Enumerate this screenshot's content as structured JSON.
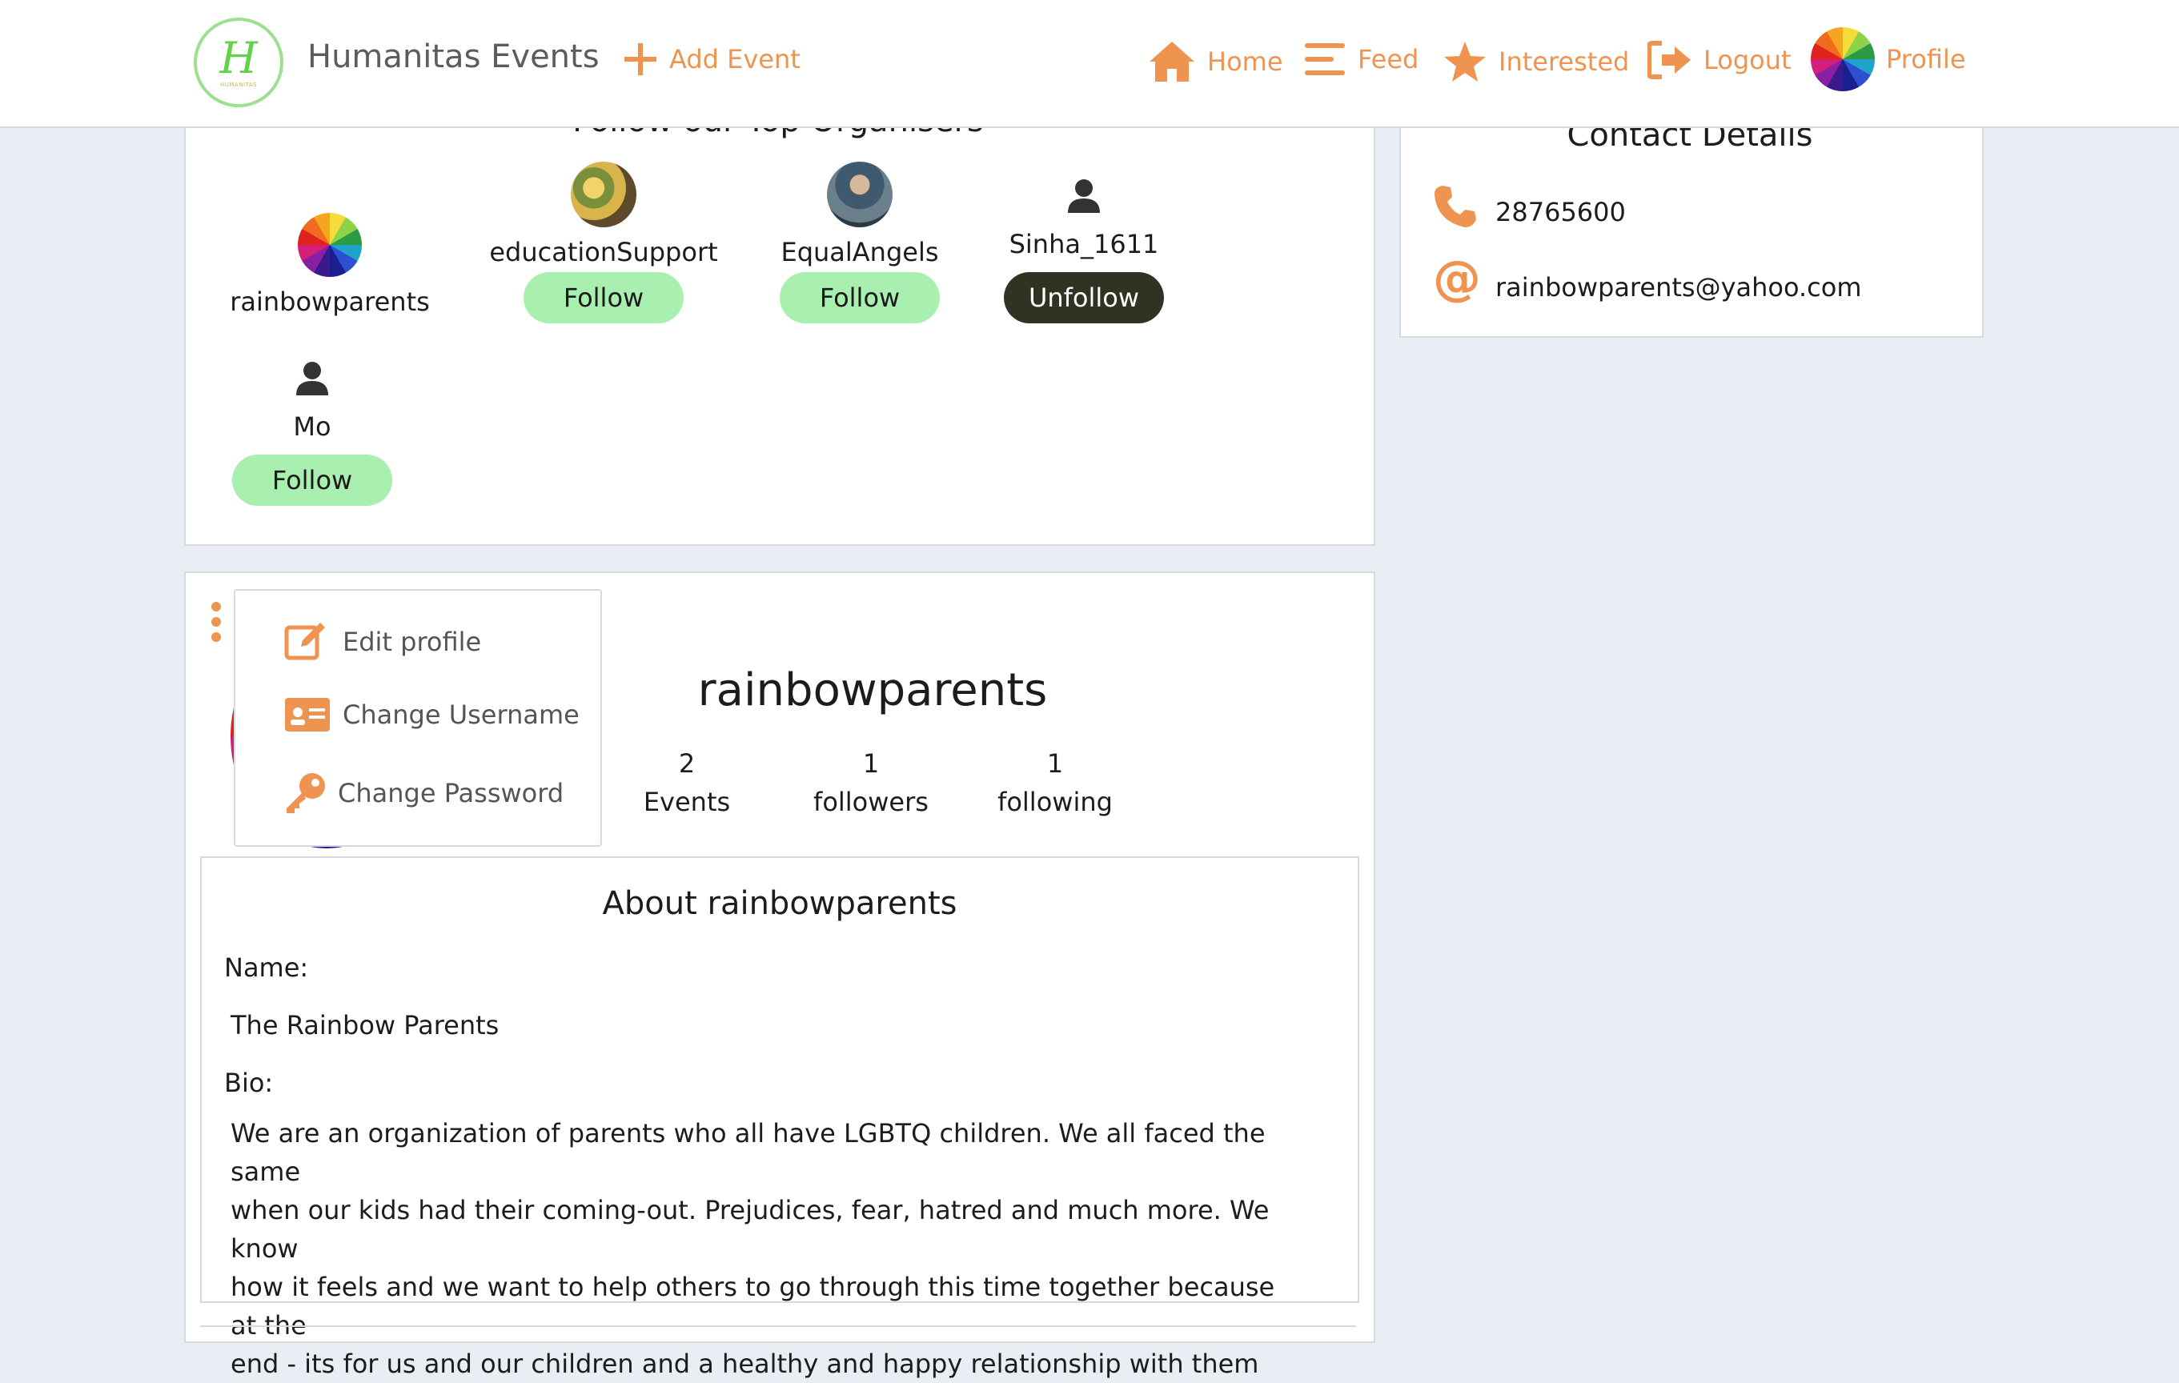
{
  "nav": {
    "logo_letter": "H",
    "logo_small_text": "HUMANITAS",
    "brand": "Humanitas Events",
    "add_event": "Add Event",
    "home": "Home",
    "feed": "Feed",
    "interested": "Interested",
    "logout": "Logout",
    "profile": "Profile"
  },
  "organisers": {
    "title": "Follow our Top Organisers",
    "items": [
      {
        "name": "rainbowparents"
      },
      {
        "name": "educationSupport",
        "button": "Follow"
      },
      {
        "name": "EqualAngels",
        "button": "Follow"
      },
      {
        "name": "Sinha_1611",
        "button": "Unfollow"
      },
      {
        "name": "Mo",
        "button": "Follow"
      }
    ]
  },
  "contact": {
    "title": "Contact Details",
    "phone": "28765600",
    "email": "rainbowparents@yahoo.com"
  },
  "profile": {
    "username": "rainbowparents",
    "stats": [
      {
        "value": "2",
        "label": "Events"
      },
      {
        "value": "1",
        "label": "followers"
      },
      {
        "value": "1",
        "label": "following"
      }
    ],
    "menu": {
      "edit": "Edit profile",
      "change_username": "Change Username",
      "change_password": "Change Password"
    }
  },
  "about": {
    "title": "About rainbowparents",
    "name_label": "Name:",
    "name_value": "The Rainbow Parents",
    "bio_label": "Bio:",
    "bio_lines": [
      "We are an organization of parents who all have LGBTQ children. We all faced the same",
      "when our kids had their coming-out. Prejudices, fear, hatred and much more. We know",
      "how it feels and we want to help others to go through this time together because at the",
      "end - its for us and our children and a healthy and happy relationship with them"
    ]
  },
  "colors": {
    "accent": "#ef9350",
    "follow_bg": "#a8efb0",
    "unfollow_bg": "#2f3321",
    "page_bg": "#e8eef3"
  }
}
